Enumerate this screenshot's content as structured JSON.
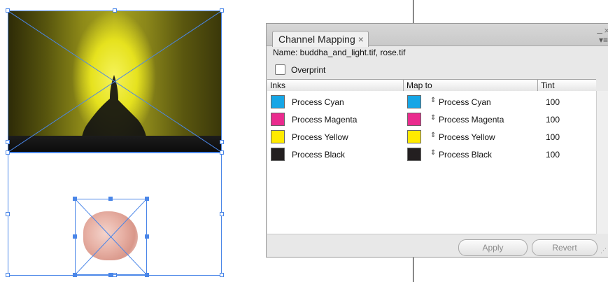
{
  "panel": {
    "tab_title": "Channel Mapping",
    "tab_close_glyph": "×",
    "minimize_glyph": "–",
    "close_glyph": "×",
    "menu_glyph": "▾≡",
    "name_line": "Name: buddha_and_light.tif, rose.tif",
    "overprint_label": "Overprint",
    "columns": {
      "inks": "Inks",
      "map_to": "Map to",
      "tint": "Tint"
    },
    "rows": [
      {
        "ink": "Process Cyan",
        "ink_color": "#16a6e6",
        "map_to": "Process Cyan",
        "map_color": "#16a6e6",
        "tint": "100"
      },
      {
        "ink": "Process Magenta",
        "ink_color": "#ea2b8e",
        "map_to": "Process Magenta",
        "map_color": "#ea2b8e",
        "tint": "100"
      },
      {
        "ink": "Process Yellow",
        "ink_color": "#ffea00",
        "map_to": "Process Yellow",
        "map_color": "#ffea00",
        "tint": "100"
      },
      {
        "ink": "Process Black",
        "ink_color": "#231f20",
        "map_to": "Process Black",
        "map_color": "#231f20",
        "tint": "100"
      }
    ],
    "stepper_glyph": "⇕",
    "buttons": {
      "apply": "Apply",
      "revert": "Revert"
    }
  },
  "colors": {
    "selection_blue": "#4a86e8",
    "panel_bg": "#e8e8e8"
  },
  "icons": {
    "tab_close": "close-icon",
    "stepper": "chevron-updown-icon",
    "panel_menu": "menu-icon",
    "resize": "resize-grip-icon"
  }
}
